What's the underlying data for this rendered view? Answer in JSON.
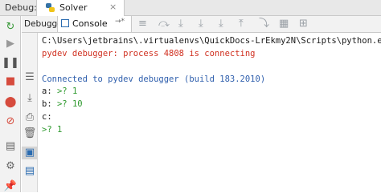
{
  "title_bar": {
    "debug_label": "Debug:",
    "run_tab": "Solver"
  },
  "tabs": {
    "debugger": "Debugger",
    "console": "Console"
  },
  "console_lines": [
    {
      "text": "C:\\Users\\jetbrains\\.virtualenvs\\QuickDocs-LrEkmy2N\\Scripts\\python.exe \"C:",
      "color": "black"
    },
    {
      "text": "pydev debugger: process 4808 is connecting",
      "color": "red"
    },
    {
      "text": "",
      "color": "black"
    },
    {
      "text": "Connected to pydev debugger (build 183.2010)",
      "color": "blue"
    },
    {
      "prompt_label": "a:",
      "prompt_value": ">? 1"
    },
    {
      "prompt_label": "b:",
      "prompt_value": ">? 10"
    },
    {
      "prompt_label": "c:",
      "prompt_value": ""
    },
    {
      "prompt_label": "",
      "prompt_value": ">? 1"
    }
  ],
  "colors": {
    "accent": "#2a6bb0",
    "error_text": "#d03020",
    "info_text": "#2f5fad",
    "prompt": "#2f9a2f"
  }
}
